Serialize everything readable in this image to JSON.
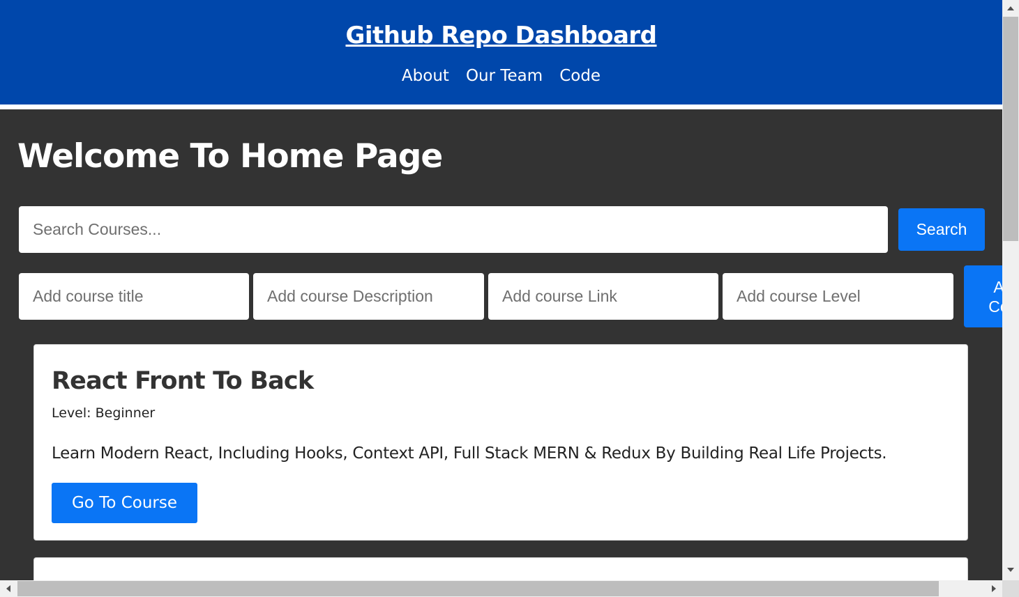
{
  "header": {
    "title": "Github Repo Dashboard",
    "nav": [
      {
        "label": "About"
      },
      {
        "label": "Our Team"
      },
      {
        "label": "Code"
      }
    ]
  },
  "main": {
    "heading": "Welcome To Home Page",
    "search": {
      "placeholder": "Search Courses...",
      "value": "",
      "button_label": "Search"
    },
    "add_form": {
      "title_placeholder": "Add course title",
      "description_placeholder": "Add course Description",
      "link_placeholder": "Add course Link",
      "level_placeholder": "Add course Level",
      "button_label_line1": "A",
      "button_label_line2": "Co"
    },
    "courses": [
      {
        "title": "React Front To Back",
        "level": "Level: Beginner",
        "description": "Learn Modern React, Including Hooks, Context API, Full Stack MERN & Redux By Building Real Life Projects.",
        "button_label": "Go To Course"
      }
    ]
  },
  "colors": {
    "header_bg": "#0047ab",
    "page_bg": "#333333",
    "accent": "#0a75f5"
  }
}
